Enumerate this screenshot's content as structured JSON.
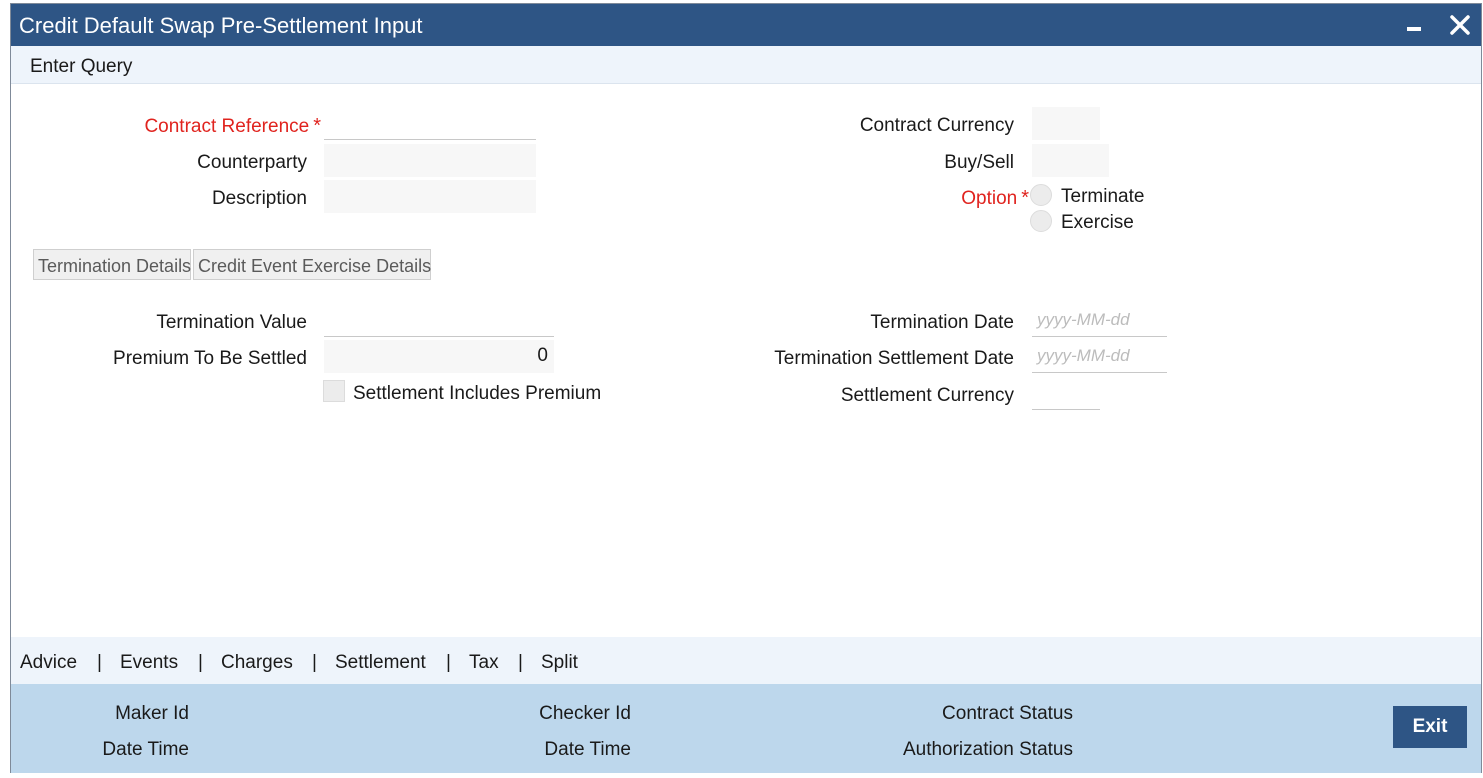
{
  "window": {
    "title": "Credit Default Swap Pre-Settlement Input"
  },
  "menu": {
    "enter_query": "Enter Query"
  },
  "header_fields": {
    "contract_reference_label": "Contract Reference",
    "required_marker": "*",
    "counterparty_label": "Counterparty",
    "description_label": "Description",
    "contract_currency_label": "Contract Currency",
    "buy_sell_label": "Buy/Sell",
    "option_label": "Option",
    "option_terminate": "Terminate",
    "option_exercise": "Exercise"
  },
  "tabs": [
    {
      "label": "Termination Details"
    },
    {
      "label": "Credit Event Exercise Details"
    }
  ],
  "termination": {
    "termination_value_label": "Termination Value",
    "premium_label": "Premium To Be Settled",
    "premium_value": "0",
    "settlement_includes_premium_label": "Settlement Includes Premium",
    "termination_date_label": "Termination Date",
    "termination_date_placeholder": "yyyy-MM-dd",
    "termination_settlement_date_label": "Termination Settlement Date",
    "termination_settlement_date_placeholder": "yyyy-MM-dd",
    "settlement_currency_label": "Settlement Currency"
  },
  "links": {
    "items": [
      "Advice",
      "Events",
      "Charges",
      "Settlement",
      "Tax",
      "Split"
    ],
    "separator": "|"
  },
  "footer": {
    "maker_id_label": "Maker Id",
    "date_time_label": "Date Time",
    "checker_id_label": "Checker Id",
    "contract_status_label": "Contract Status",
    "authorization_status_label": "Authorization Status",
    "exit_label": "Exit"
  },
  "colors": {
    "title_bar": "#2e5585",
    "required": "#e0231e",
    "footer_bg": "#bdd7ec",
    "exit_button": "#2e5585"
  }
}
